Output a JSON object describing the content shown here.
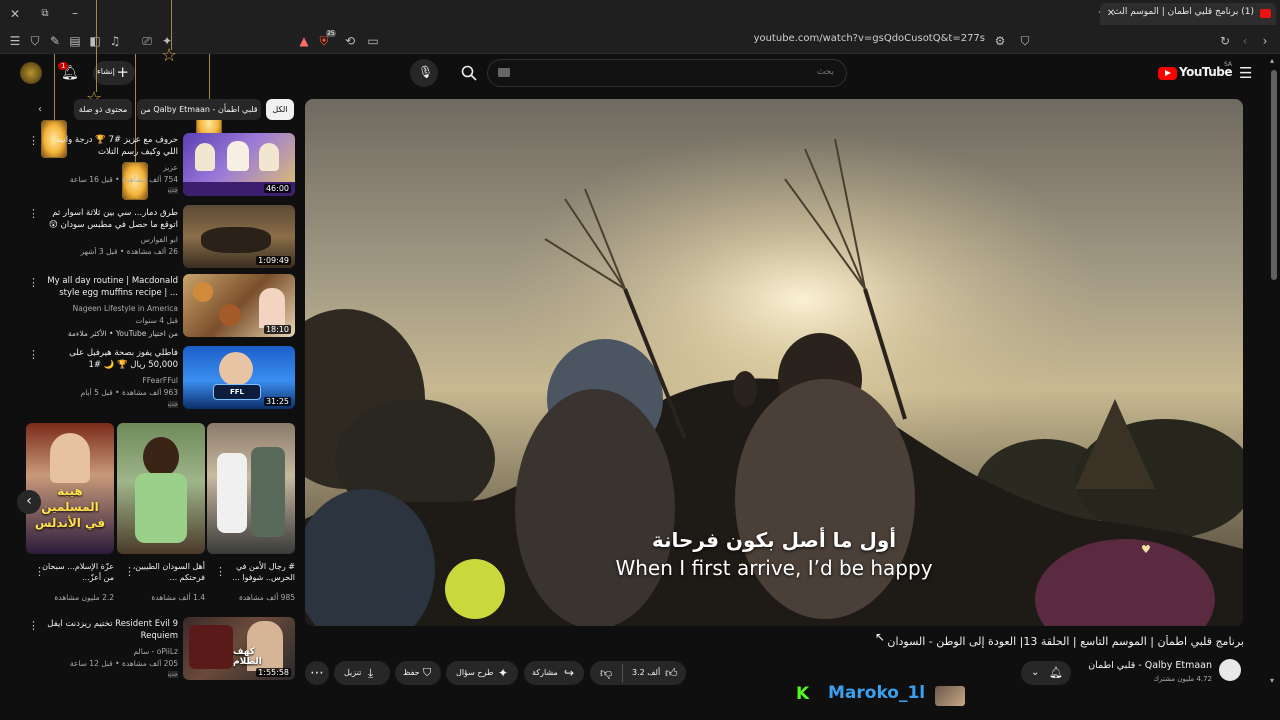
{
  "browser": {
    "tab_title": "(1) برنامج قلبي اطمأن | الموسم الث",
    "url": "youtube.com/watch?v=gsQdoCusotQ&t=277s",
    "shield_badge": "25"
  },
  "header": {
    "logo_text": "YouTube",
    "region": "SA",
    "search_placeholder": "بحث",
    "create_label": "إنشاء",
    "notif_count": "1"
  },
  "chips": [
    {
      "label": "الكل"
    },
    {
      "label": "من Qalby Etmaan - قلبي اطمأن"
    },
    {
      "label": "محتوى ذو صلة"
    }
  ],
  "recommendations": [
    {
      "title": "حروف مع عزيز #7 🏆 درجة وانيه اللي وكيف رسم التلات",
      "channel": "عزيز",
      "meta": "754 ألف مشاهدة • قبل 16 ساعة",
      "duration": "46:00",
      "badge": "جديد"
    },
    {
      "title": "طرق دمار... سي بين ثلاثة اسوار ثم اتوقع ما حصل في مطبس سودان 😲",
      "channel": "ابو الفوارس",
      "meta": "26 ألف مشاهدة • قبل 3 أشهر",
      "duration": "1:09:49",
      "badge": ""
    },
    {
      "title": "My all day routine | Macdonald style egg muffins recipe | ...",
      "channel": "Nageen Lifestyle in America",
      "meta": "قبل 4 سنوات",
      "duration": "18:10",
      "badge": "من اختيار YouTube • الأكثر ملاءمة"
    },
    {
      "title": "فاطلي يفوز بصحة هيرفيل على 50,000 ريال 🏆 🌙 #1",
      "channel": "FFearFFul",
      "meta": "963 ألف مشاهدة • قبل 5 أيام",
      "duration": "31:25",
      "badge": "جديد"
    },
    {
      "title": "Resident Evil 9 تختيم ريزدنت ايفل Requiem",
      "channel": "oPiiLz - سالم",
      "meta": "205 ألف مشاهدة • قبل 12 ساعة",
      "duration": "1:55:58",
      "badge": "جديد"
    }
  ],
  "shorts": [
    {
      "title": "عزّة الإسلام... سبحان من أعزّ...",
      "views": "2.2 مليون مشاهدة",
      "overlay": "هيبة المسلمين في الأندلس"
    },
    {
      "title": "أهل السودان الطيبين، فرحتكم ...",
      "views": "1.4 ألف مشاهدة",
      "overlay": ""
    },
    {
      "title": "# رجال الأمن في الحرس.. شوفوا ...",
      "views": "985 ألف مشاهدة",
      "overlay": ""
    }
  ],
  "player": {
    "subtitle_ar": "أول ما أصل بكون فرحانة",
    "subtitle_en": "When I first arrive, I’d be happy"
  },
  "video": {
    "title": "برنامج قلبي اطمأن | الموسم التاسع | الحلقة 13| العودة إلى الوطن - السودان",
    "channel": "Qalby Etmaan - قلبي اطمأن",
    "subscribers": "4.72 مليون مشترك",
    "likes": "3.2 ألف",
    "share_label": "مشاركة",
    "ask_label": "طرح سؤال",
    "save_label": "حفظ",
    "download_label": "تنزيل"
  },
  "overlay": {
    "streamer_name": "Maroko_1l",
    "streamer_icon": "K"
  }
}
